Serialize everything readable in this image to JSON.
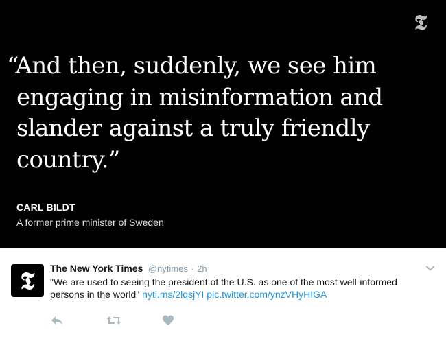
{
  "media": {
    "logo_icon": "nyt-logo-icon",
    "quote_lines": [
      "“And then, suddenly, we see him",
      "engaging in misinformation and",
      "slander against a truly friendly",
      "country.”"
    ],
    "speaker_name": "CARL BILDT",
    "speaker_title": "A former prime minister of Sweden"
  },
  "tweet": {
    "avatar_icon": "nyt-logo-icon",
    "display_name": "The New York Times",
    "handle": "@nytimes",
    "separator": "·",
    "time": "2h",
    "text": "\"We are used to seeing the president of the U.S. as one of the most well-informed persons in the world\"",
    "links": [
      "nyti.ms/2lqsjYI",
      "pic.twitter.com/ynzVHyHIGA"
    ],
    "actions": [
      {
        "name": "reply",
        "icon": "reply-icon"
      },
      {
        "name": "retweet",
        "icon": "retweet-icon"
      },
      {
        "name": "like",
        "icon": "heart-icon"
      }
    ]
  },
  "colors": {
    "media_bg": "#000000",
    "link": "#1b95e0",
    "muted": "#8899a6",
    "action_icon": "#aab8c2"
  }
}
